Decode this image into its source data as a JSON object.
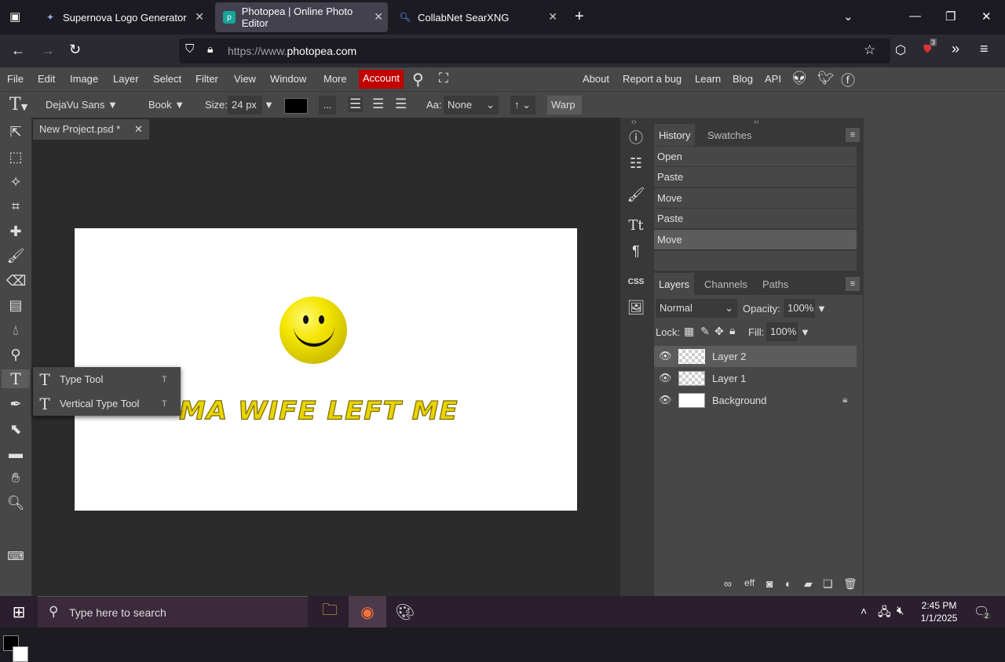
{
  "browser": {
    "tabs": [
      {
        "title": "Supernova Logo Generator",
        "active": false
      },
      {
        "title": "Photopea | Online Photo Editor",
        "active": true
      },
      {
        "title": "CollabNet SearXNG",
        "active": false
      }
    ],
    "url_prefix": "https://www.",
    "url_domain": "photopea.com",
    "extension_badge": "3"
  },
  "photopea": {
    "menu": [
      "File",
      "Edit",
      "Image",
      "Layer",
      "Select",
      "Filter",
      "View",
      "Window",
      "More"
    ],
    "account_label": "Account",
    "right_links": [
      "About",
      "Report a bug",
      "Learn",
      "Blog",
      "API"
    ],
    "options": {
      "font_family": "DejaVu Sans",
      "font_style": "Book",
      "size_label": "Size:",
      "size_value": "24 px",
      "color": "#000000",
      "more_label": "...",
      "aa_label": "Aa:",
      "aa_value": "None",
      "spacing_value": "↑",
      "warp_label": "Warp"
    },
    "document_tab": "New Project.psd *",
    "canvas_text": "MA WIFE LEFT ME",
    "tool_flyout": [
      {
        "label": "Type Tool",
        "shortcut": "T"
      },
      {
        "label": "Vertical Type Tool",
        "shortcut": "T"
      }
    ],
    "history_panel": {
      "tabs": [
        "History",
        "Swatches"
      ],
      "items": [
        "Open",
        "Paste",
        "Move",
        "Paste",
        "Move"
      ]
    },
    "layers_panel": {
      "tabs": [
        "Layers",
        "Channels",
        "Paths"
      ],
      "blend_mode": "Normal",
      "opacity_label": "Opacity:",
      "opacity_value": "100%",
      "lock_label": "Lock:",
      "fill_label": "Fill:",
      "fill_value": "100%",
      "layers": [
        {
          "name": "Layer 2",
          "selected": true
        },
        {
          "name": "Layer 1",
          "selected": false
        },
        {
          "name": "Background",
          "selected": false,
          "locked": true
        }
      ]
    },
    "iconcol_css_label": "CSS"
  },
  "taskbar": {
    "search_placeholder": "Type here to search",
    "time": "2:45 PM",
    "date": "1/1/2025",
    "notification_count": "2"
  },
  "colors": {
    "account_red": "#c10000",
    "logo_yellow": "#e8d400"
  }
}
